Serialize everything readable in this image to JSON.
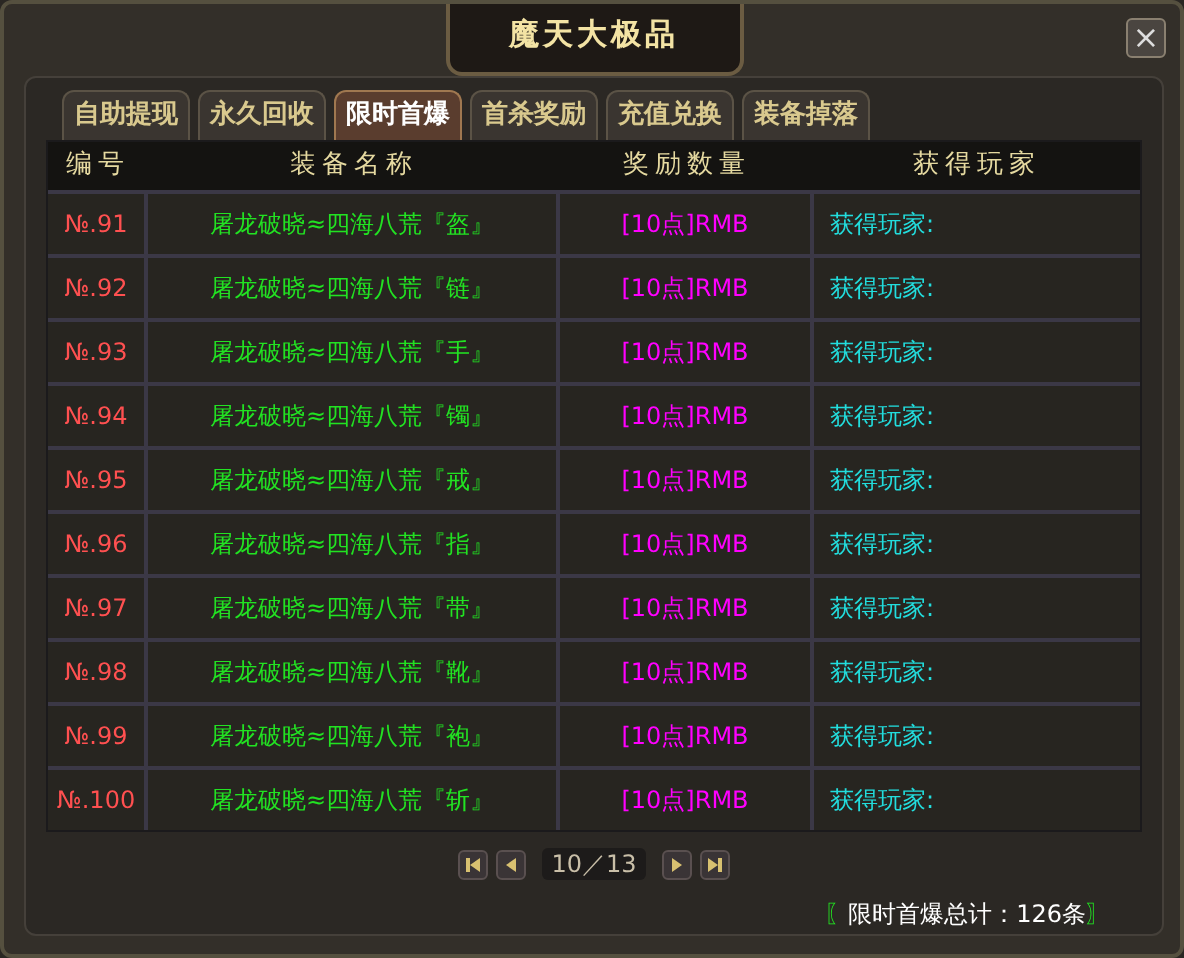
{
  "window": {
    "title": "魔天大极品",
    "close": "×"
  },
  "tabs": [
    {
      "label": "自助提现",
      "selected": false
    },
    {
      "label": "永久回收",
      "selected": false
    },
    {
      "label": "限时首爆",
      "selected": true
    },
    {
      "label": "首杀奖励",
      "selected": false
    },
    {
      "label": "充值兑换",
      "selected": false
    },
    {
      "label": "装备掉落",
      "selected": false
    }
  ],
  "table": {
    "columns": [
      "编号",
      "装备名称",
      "奖励数量",
      "获得玩家"
    ],
    "rows": [
      {
        "number": "№.91",
        "item": "屠龙破晓≈四海八荒『盔』",
        "reward": "[10点]RMB",
        "player": "获得玩家:"
      },
      {
        "number": "№.92",
        "item": "屠龙破晓≈四海八荒『链』",
        "reward": "[10点]RMB",
        "player": "获得玩家:"
      },
      {
        "number": "№.93",
        "item": "屠龙破晓≈四海八荒『手』",
        "reward": "[10点]RMB",
        "player": "获得玩家:"
      },
      {
        "number": "№.94",
        "item": "屠龙破晓≈四海八荒『镯』",
        "reward": "[10点]RMB",
        "player": "获得玩家:"
      },
      {
        "number": "№.95",
        "item": "屠龙破晓≈四海八荒『戒』",
        "reward": "[10点]RMB",
        "player": "获得玩家:"
      },
      {
        "number": "№.96",
        "item": "屠龙破晓≈四海八荒『指』",
        "reward": "[10点]RMB",
        "player": "获得玩家:"
      },
      {
        "number": "№.97",
        "item": "屠龙破晓≈四海八荒『带』",
        "reward": "[10点]RMB",
        "player": "获得玩家:"
      },
      {
        "number": "№.98",
        "item": "屠龙破晓≈四海八荒『靴』",
        "reward": "[10点]RMB",
        "player": "获得玩家:"
      },
      {
        "number": "№.99",
        "item": "屠龙破晓≈四海八荒『袍』",
        "reward": "[10点]RMB",
        "player": "获得玩家:"
      },
      {
        "number": "№.100",
        "item": "屠龙破晓≈四海八荒『斩』",
        "reward": "[10点]RMB",
        "player": "获得玩家:"
      }
    ]
  },
  "pagination": {
    "page": "10／13"
  },
  "total": {
    "open": "〖",
    "text": "限时首爆总计：126条",
    "close": "〗"
  }
}
